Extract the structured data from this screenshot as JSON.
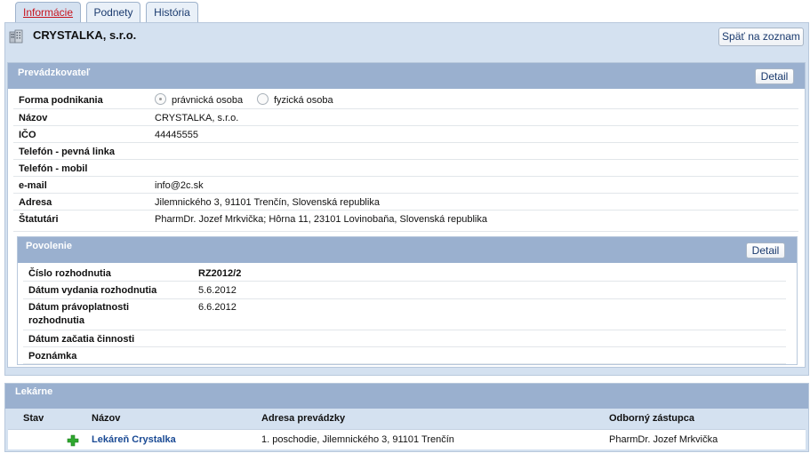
{
  "tabs": [
    {
      "label": "Informácie",
      "active": true
    },
    {
      "label": "Podnety",
      "active": false
    },
    {
      "label": "História",
      "active": false
    }
  ],
  "header": {
    "company_name": "CRYSTALKA, s.r.o.",
    "back_button": "Späť na zoznam",
    "icon": "building-icon"
  },
  "prevadzkovatel": {
    "title": "Prevádzkovateľ",
    "detail_button": "Detail",
    "forma_label": "Forma podnikania",
    "forma_options": [
      "právnická osoba",
      "fyzická osoba"
    ],
    "forma_selected": "právnická osoba",
    "fields": [
      {
        "label": "Názov",
        "value": "CRYSTALKA, s.r.o."
      },
      {
        "label": "IČO",
        "value": "44445555"
      },
      {
        "label": "Telefón - pevná linka",
        "value": ""
      },
      {
        "label": "Telefón - mobil",
        "value": ""
      },
      {
        "label": "e-mail",
        "value": "info@2c.sk"
      },
      {
        "label": "Adresa",
        "value": "Jilemnického 3, 91101 Trenčín, Slovenská republika"
      },
      {
        "label": "Štatutári",
        "value": "PharmDr. Jozef Mrkvička; Hôrna 11, 23101 Lovinobaňa, Slovenská republika"
      }
    ]
  },
  "povolenie": {
    "title": "Povolenie",
    "detail_button": "Detail",
    "fields": [
      {
        "label": "Číslo rozhodnutia",
        "value": "RZ2012/2"
      },
      {
        "label": "Dátum vydania rozhodnutia",
        "value": "5.6.2012"
      },
      {
        "label": "Dátum právoplatnosti",
        "label2": "rozhodnutia",
        "value": "6.6.2012"
      },
      {
        "label": "Dátum začatia činnosti",
        "value": ""
      },
      {
        "label": "Poznámka",
        "value": ""
      }
    ]
  },
  "lekarne": {
    "title": "Lekárne",
    "columns": [
      "Stav",
      "Názov",
      "Adresa prevádzky",
      "Odborný zástupca"
    ],
    "rows": [
      {
        "stav_icon": "green-cross-icon",
        "nazov": "Lekáreň Crystalka",
        "adresa": "1. poschodie, Jilemnického 3, 91101 Trenčín",
        "zastupca": "PharmDr. Jozef Mrkvička"
      }
    ]
  },
  "colors": {
    "accent": "#9ab0cf",
    "panel_bg": "#d4e1f0",
    "active_tab_text": "#c8141e",
    "link": "#1a4a94",
    "pharmacy_cross": "#2fa82f"
  }
}
